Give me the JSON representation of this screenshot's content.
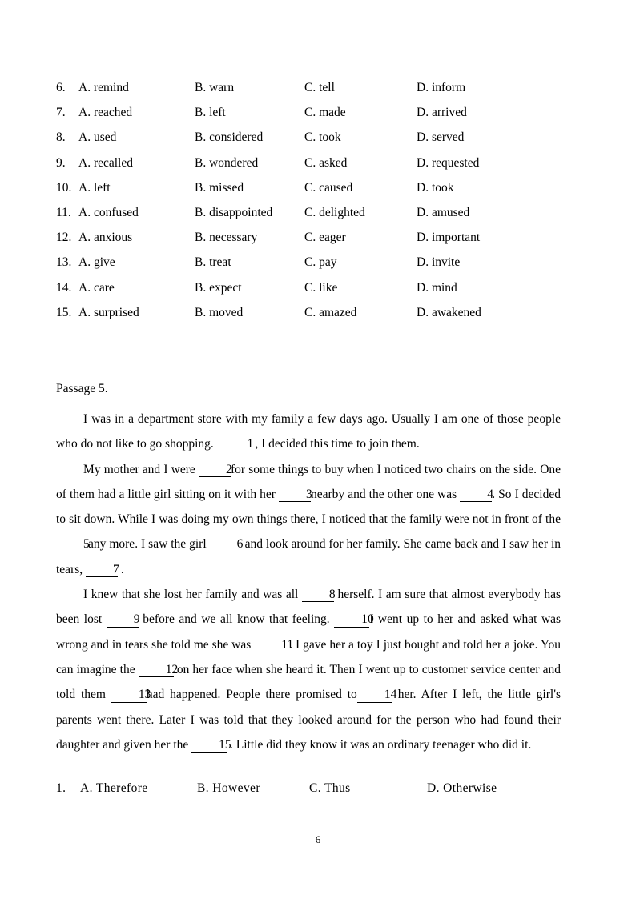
{
  "document": {
    "page_number": "6"
  },
  "options_block": {
    "rows": [
      {
        "num": "6.",
        "a": "A. remind",
        "b": "B. warn",
        "c": "C. tell",
        "d": "D. inform"
      },
      {
        "num": "7.",
        "a": "A. reached",
        "b": "B. left",
        "c": "C. made",
        "d": "D. arrived"
      },
      {
        "num": "8.",
        "a": "A. used",
        "b": "B. considered",
        "c": "C. took",
        "d": "D. served"
      },
      {
        "num": "9.",
        "a": "A. recalled",
        "b": "B. wondered",
        "c": "C. asked",
        "d": "D. requested"
      },
      {
        "num": "10.",
        "a": "A. left",
        "b": "B. missed",
        "c": "C. caused",
        "d": "D. took"
      },
      {
        "num": "11.",
        "a": "A. confused",
        "b": "B. disappointed",
        "c": "C. delighted",
        "d": "D. amused"
      },
      {
        "num": "12.",
        "a": "A. anxious",
        "b": "B. necessary",
        "c": "C. eager",
        "d": "D. important"
      },
      {
        "num": "13.",
        "a": "A. give",
        "b": "B. treat",
        "c": "C. pay",
        "d": "D. invite"
      },
      {
        "num": "14.",
        "a": "A. care",
        "b": "B. expect",
        "c": "C. like",
        "d": "D. mind"
      },
      {
        "num": "15.",
        "a": "A. surprised",
        "b": "B. moved",
        "c": "C. amazed",
        "d": "D. awakened"
      }
    ]
  },
  "passage": {
    "title": "Passage 5.",
    "paragraph1": {
      "t1": "I was in a department store with my family a few days ago. Usually I am one of those people who do not like to go shopping.",
      "blank1": "1",
      "t2": ", I decided this time to join them."
    },
    "paragraph2": {
      "t1": "My mother and I were",
      "blank2": "2",
      "t2": "for some things to buy when I noticed two chairs on the side. One of them had a little girl sitting on it with her",
      "blank3": "3",
      "t3": "nearby and the other one was",
      "blank4": "4",
      "t4": ". So I decided to sit down. While I was doing my own things there,  I noticed that the family were not in front of the",
      "blank5": "5",
      "t5": "any more. I saw the girl",
      "blank6": "6",
      "t6": "and look around for her family. She came back and I saw her in tears,",
      "blank7": "7",
      "t7": "."
    },
    "paragraph3": {
      "t1": "I knew that she lost her family and was all",
      "blank8": "8",
      "t2": "herself.  I am sure that almost everybody has been lost",
      "blank9": "9",
      "t3": "before and we all know that feeling.",
      "blank10": "10",
      "t4": "I went up to her and asked what was wrong and in tears she told me she was",
      "blank11": "11",
      "t5": ".  I gave her a toy I just bought and told her a joke.  You can imagine the",
      "blank12": "12",
      "t6": "on her face when she heard it.  Then I went up to customer service center and told them",
      "blank13": "13",
      "t7": "had happened. People there promised to",
      "blank14": "14",
      "t8": "her. After I left,  the little girl's parents went there.  Later I was told that they looked around for the person who had found their daughter and given her the",
      "blank15": "15",
      "t9": ". Little did they know it was an ordinary teenager who did it."
    }
  },
  "question1": {
    "num": "1.",
    "a": "A.  Therefore",
    "b": "B.  However",
    "c": "C.  Thus",
    "d": "D.  Otherwise"
  }
}
